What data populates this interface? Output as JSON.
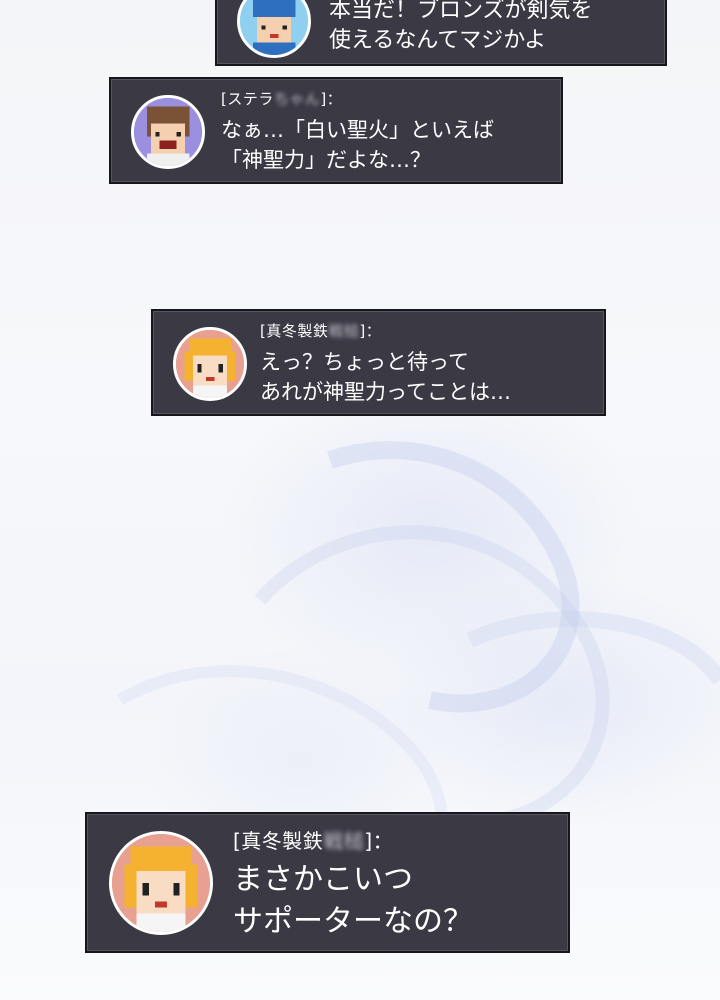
{
  "messages": [
    {
      "speaker_prefix": "",
      "speaker_blurred": "",
      "speaker_suffix": "",
      "lines": [
        "本当だ！ブロンズが剣気を",
        "使えるなんてマジかよ"
      ],
      "avatar": "blue-cap-boy-icon",
      "avatar_bg": "#8fd0f0"
    },
    {
      "speaker_prefix": "[ステラ",
      "speaker_blurred": "ちゃん",
      "speaker_suffix": "]：",
      "lines": [
        "なぁ…「白い聖火」といえば",
        "「神聖力」だよな…？"
      ],
      "avatar": "brown-hair-boy-icon",
      "avatar_bg": "#9b8fe0"
    },
    {
      "speaker_prefix": "[真冬製鉄",
      "speaker_blurred": "戦槌",
      "speaker_suffix": "]：",
      "lines": [
        "えっ？ちょっと待って",
        "あれが神聖力ってことは…"
      ],
      "avatar": "blonde-girl-icon",
      "avatar_bg": "#e8a090"
    },
    {
      "speaker_prefix": "[真冬製鉄",
      "speaker_blurred": "戦槌",
      "speaker_suffix": "]：",
      "lines": [
        "まさかこいつ",
        "サポーターなの？"
      ],
      "avatar": "blonde-girl-icon",
      "avatar_bg": "#e8a090"
    }
  ],
  "colors": {
    "box_bg": "#3a3944",
    "box_border": "#16161c",
    "text": "#ffffff"
  }
}
